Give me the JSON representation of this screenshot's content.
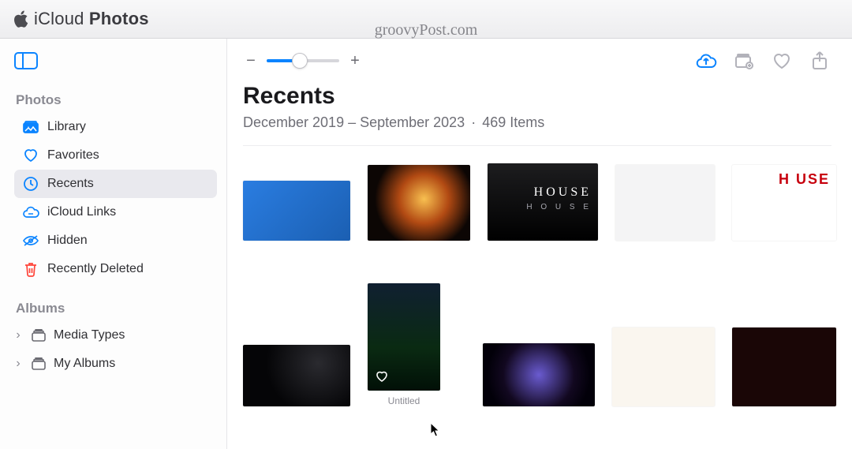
{
  "header": {
    "brand": "iCloud",
    "app": "Photos",
    "watermark": "groovyPost.com"
  },
  "sidebar": {
    "sections": {
      "photos_label": "Photos",
      "albums_label": "Albums"
    },
    "items": {
      "library": {
        "label": "Library"
      },
      "favorites": {
        "label": "Favorites"
      },
      "recents": {
        "label": "Recents"
      },
      "links": {
        "label": "iCloud Links"
      },
      "hidden": {
        "label": "Hidden"
      },
      "deleted": {
        "label": "Recently Deleted"
      }
    },
    "albums": {
      "media_types": {
        "label": "Media Types"
      },
      "my_albums": {
        "label": "My Albums"
      }
    }
  },
  "main": {
    "title": "Recents",
    "date_range": "December 2019 – September 2023",
    "count_label": "469 Items"
  },
  "thumbs": {
    "r1c1_caption": "",
    "r2c2_caption": "Untitled",
    "house_logo_1": "HOUSE",
    "house_logo_small": "H O U S E",
    "house_logo_2": "H   USE"
  }
}
